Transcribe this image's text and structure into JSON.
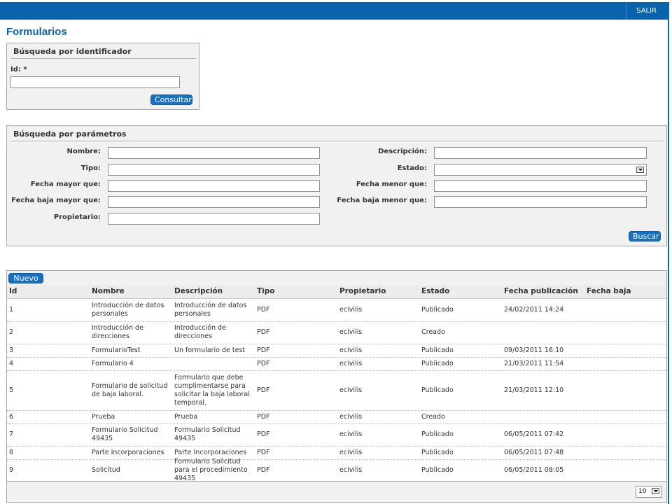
{
  "header": {
    "logout_label": "SALIR",
    "brand_color": "#0a64ad"
  },
  "page": {
    "title": "Formularios"
  },
  "id_search": {
    "title": "Búsqueda por identificador",
    "id_label": "Id: *",
    "id_value": "",
    "button_label": "Consultar"
  },
  "param_search": {
    "title": "Búsqueda por parámetros",
    "nombre_label": "Nombre:",
    "tipo_label": "Tipo:",
    "fecha_mayor_label": "Fecha mayor que:",
    "fecha_baja_mayor_label": "Fecha baja mayor que:",
    "propietario_label": "Propietario:",
    "descripcion_label": "Descripción:",
    "estado_label": "Estado:",
    "fecha_menor_label": "Fecha menor que:",
    "fecha_baja_menor_label": "Fecha baja menor que:",
    "estado_value": "",
    "button_label": "Buscar"
  },
  "table": {
    "new_button_label": "Nuevo",
    "columns": [
      "Id",
      "Nombre",
      "Descripción",
      "Tipo",
      "Propietario",
      "Estado",
      "Fecha publicación",
      "Fecha baja"
    ],
    "rows": [
      [
        "1",
        "Introducción de datos personales",
        "Introducción de datos personales",
        "PDF",
        "ecivilis",
        "Publicado",
        "24/02/2011 14:24",
        ""
      ],
      [
        "2",
        "Introducción de direcciones",
        "Introducción de direcciones",
        "PDF",
        "ecivilis",
        "Creado",
        "",
        ""
      ],
      [
        "3",
        "FormularioTest",
        "Un formulario de test",
        "PDF",
        "ecivilis",
        "Publicado",
        "09/03/2011 16:10",
        ""
      ],
      [
        "4",
        "Formulario 4",
        "",
        "PDF",
        "ecivilis",
        "Publicado",
        "21/03/2011 11:54",
        ""
      ],
      [
        "5",
        "Formulario de solicitud de baja laboral.",
        "Formulario que debe cumplimentarse para solicitar la baja laboral temporal.",
        "PDF",
        "ecivilis",
        "Publicado",
        "21/03/2011 12:10",
        ""
      ],
      [
        "6",
        "Prueba",
        "Prueba",
        "PDF",
        "ecivilis",
        "Creado",
        "",
        ""
      ],
      [
        "7",
        "Formulario Solicitud 49435",
        "Formulario Solicitud 49435",
        "PDF",
        "ecivilis",
        "Publicado",
        "06/05/2011 07:42",
        ""
      ],
      [
        "8",
        "Parte Incorporaciones",
        "Parte Incorporaciones",
        "PDF",
        "ecivilis",
        "Publicado",
        "06/05/2011 07:48",
        ""
      ],
      [
        "9",
        "Solicitud",
        "Formulario Solicitud para el procedimiento 49435",
        "PDF",
        "ecivilis",
        "Publicado",
        "06/05/2011 08:05",
        ""
      ]
    ],
    "page_size": "10"
  }
}
